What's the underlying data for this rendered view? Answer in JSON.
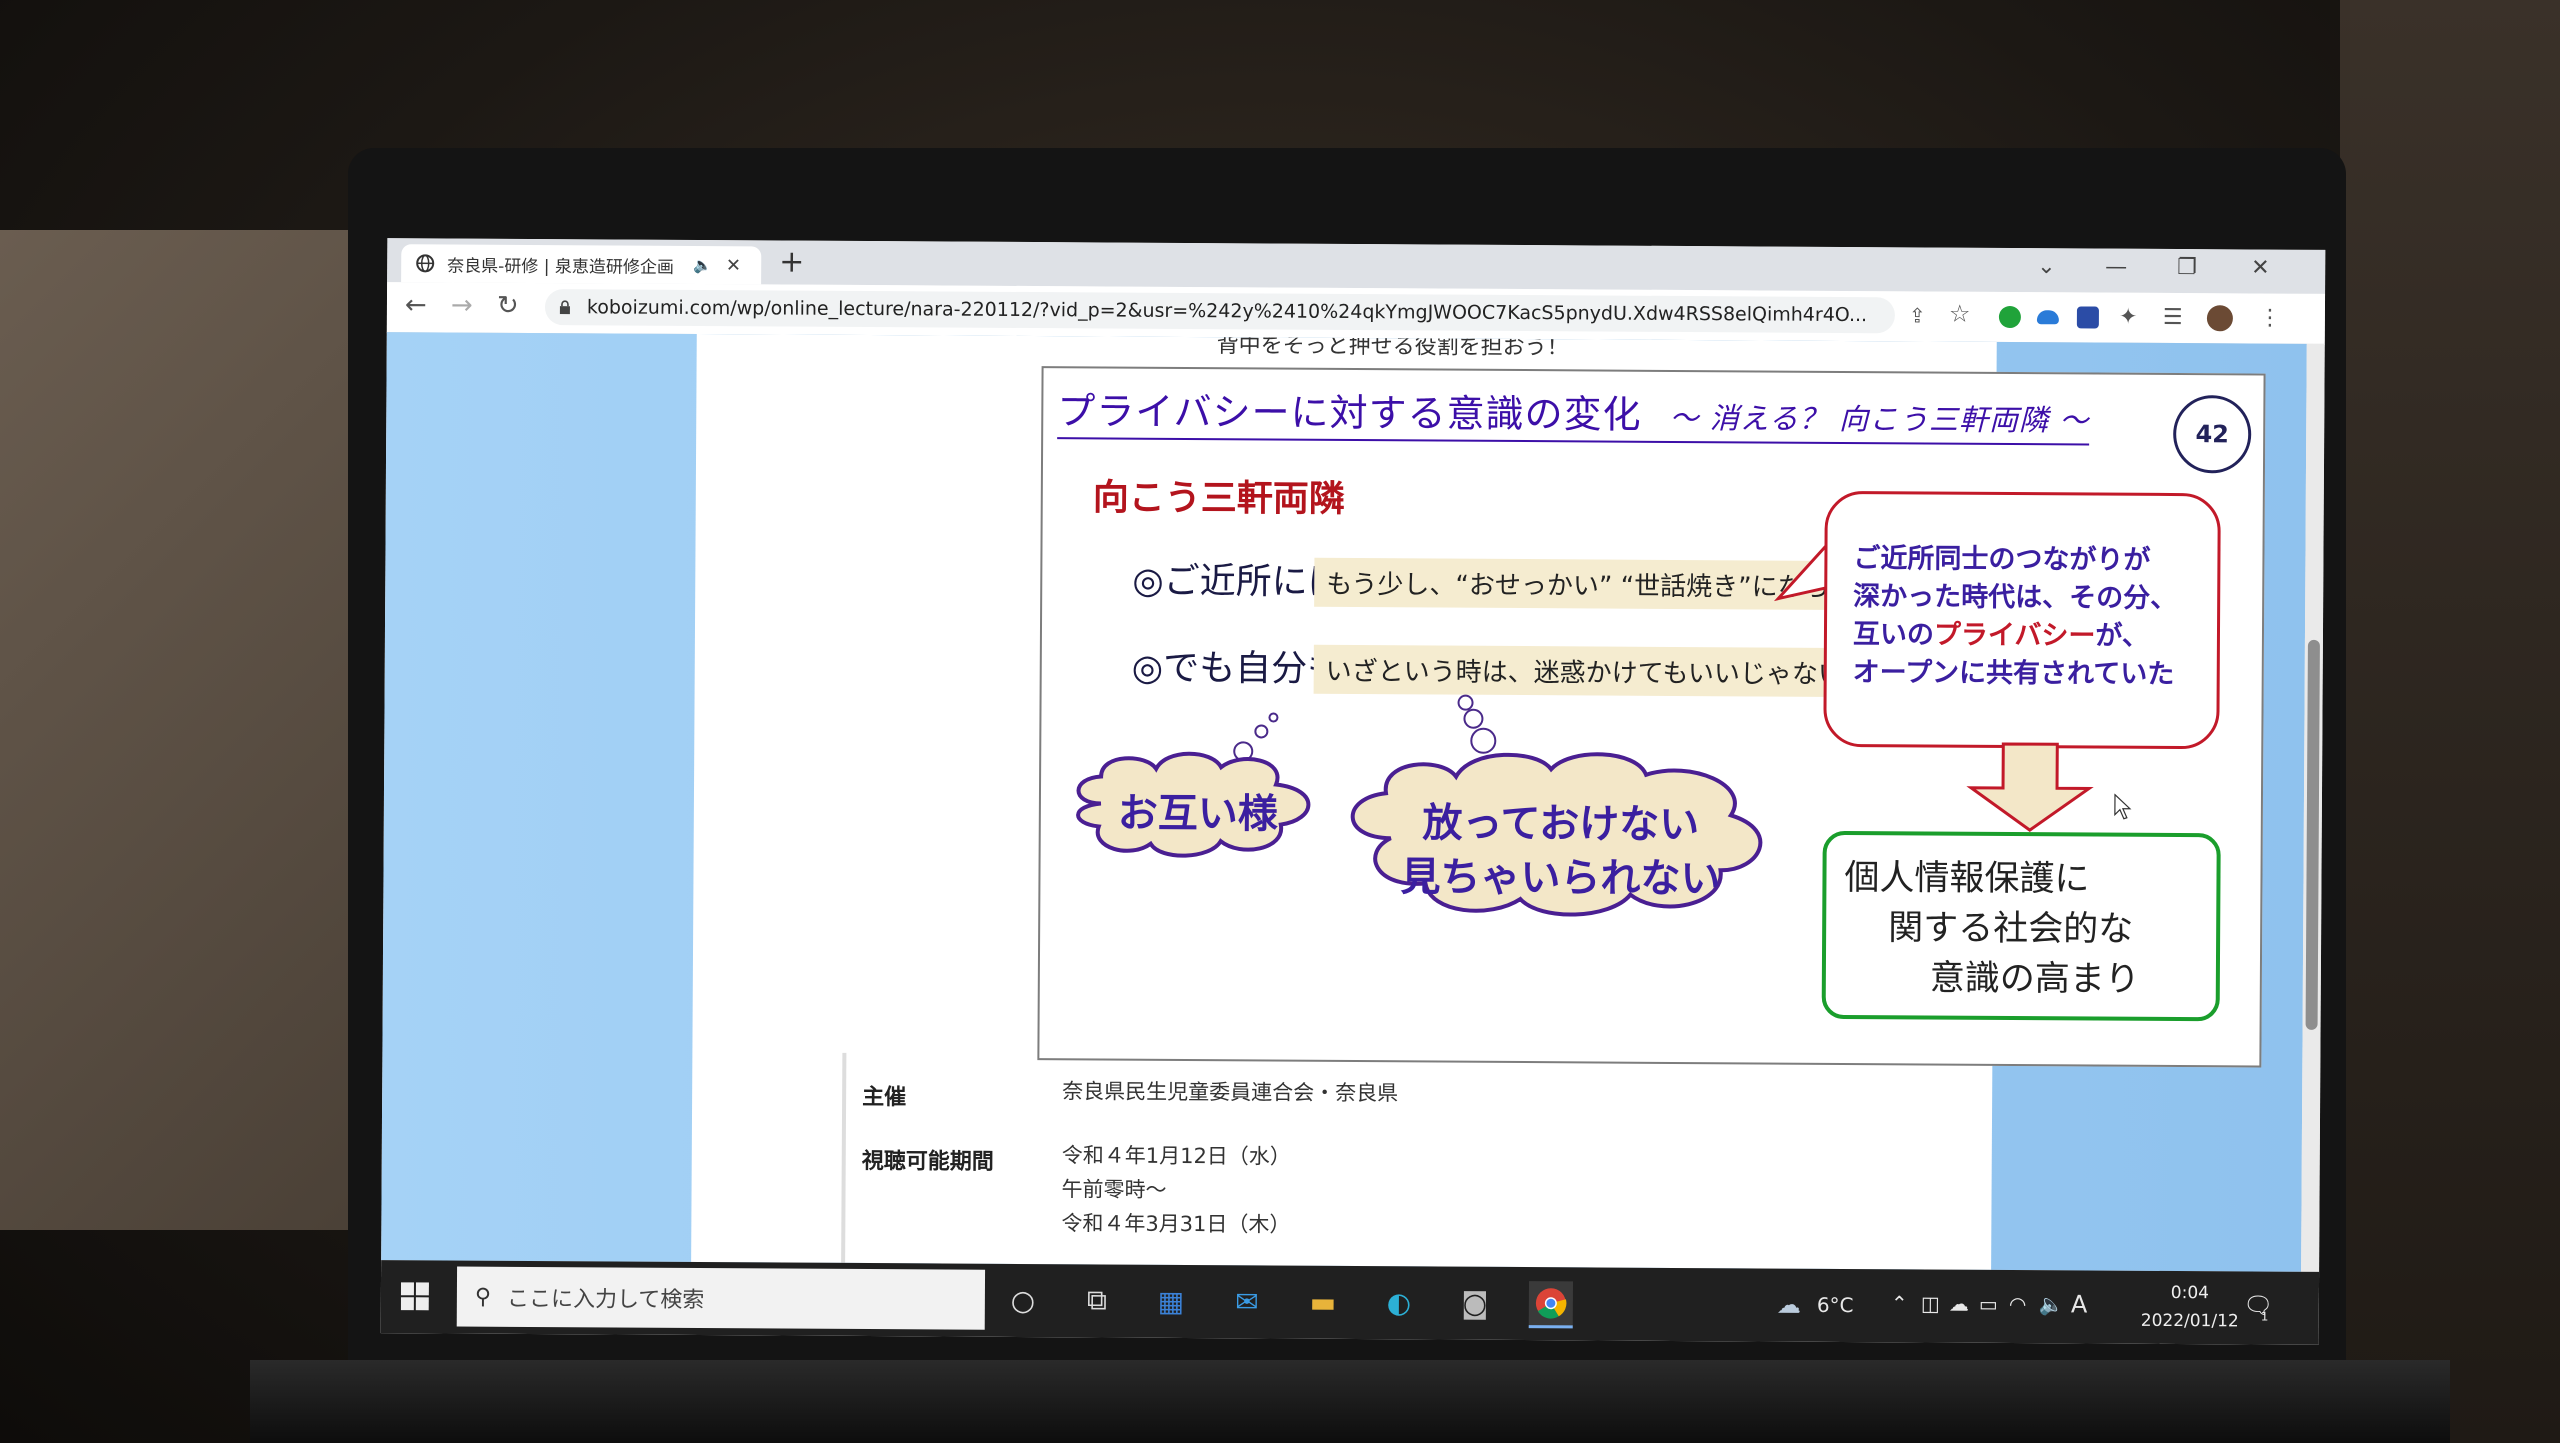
{
  "browser": {
    "tab_title": "奈良県-研修 | 泉恵造研修企画",
    "tab_audio_icon": "speaker-icon",
    "new_tab_label": "+",
    "url": "koboizumi.com/wp/online_lecture/nara-220112/?vid_p=2&usr=%242y%2410%24qkYmgJWOOC7KacS5pnydU.Xdw4RSS8elQimh4r4O..."
  },
  "page": {
    "cut_line_text": "背中をそっと押せる役割を担おう！",
    "slide": {
      "title": "プライバシーに対する意識の変化",
      "subtitle": "～ 消える？ 向こう三軒両隣 ～",
      "page_number": "42",
      "heading": "向こう三軒両隣",
      "rows": [
        {
          "label": "◎ご近所には",
          "text": "もう少し、“おせっかい” “世話焼き”になろう"
        },
        {
          "label": "◎でも自分も",
          "text": "いざという時は、迷惑かけてもいいじゃないか"
        }
      ],
      "callout_lines": [
        "ご近所同士のつながりが",
        "深かった時代は、その分、",
        "互いの",
        "プライバシー",
        "が、",
        "オープンに共有されていた"
      ],
      "clouds": [
        {
          "text": "お互い様"
        },
        {
          "line1": "放っておけない",
          "line2": "見ちゃいられない"
        }
      ],
      "greenbox_lines": [
        "個人情報保護に",
        "関する社会的な",
        "意識の高まり"
      ]
    },
    "info": [
      {
        "label": "主催",
        "values": [
          "奈良県民生児童委員連合会・奈良県"
        ]
      },
      {
        "label": "視聴可能期間",
        "values": [
          "令和４年1月12日（水）",
          "午前零時～",
          "令和４年3月31日（木）"
        ]
      }
    ]
  },
  "taskbar": {
    "search_placeholder": "ここに入力して検索",
    "weather_temp": "6°C",
    "ime_indicator": "A",
    "time": "0:04",
    "date": "2022/01/12",
    "notification_count": "1"
  }
}
